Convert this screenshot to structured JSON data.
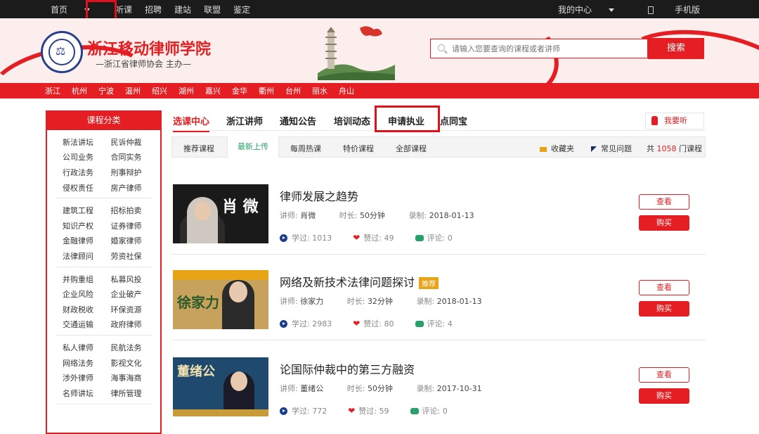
{
  "topnav": {
    "items": [
      "首页",
      "听课",
      "招聘",
      "建站",
      "联盟",
      "鉴定"
    ],
    "my_center": "我的中心",
    "mobile": "手机版"
  },
  "header": {
    "brand": "浙江移动律师学院",
    "subtitle": "—浙江省律师协会 主办—",
    "search_placeholder": "请输入您要查询的课程或者讲师",
    "search_button": "搜索"
  },
  "cities": [
    "浙江",
    "杭州",
    "宁波",
    "温州",
    "绍兴",
    "湖州",
    "嘉兴",
    "金华",
    "衢州",
    "台州",
    "丽水",
    "舟山"
  ],
  "sidebar": {
    "title": "课程分类",
    "groups": [
      [
        [
          "新法讲坛",
          "民诉仲裁"
        ],
        [
          "公司业务",
          "合同实务"
        ],
        [
          "行政法务",
          "刑事辩护"
        ],
        [
          "侵权责任",
          "房产律师"
        ]
      ],
      [
        [
          "建筑工程",
          "招标拍卖"
        ],
        [
          "知识产权",
          "证券律师"
        ],
        [
          "金融律师",
          "婚家律师"
        ],
        [
          "法律顾问",
          "劳资社保"
        ]
      ],
      [
        [
          "并购重组",
          "私募风投"
        ],
        [
          "企业风险",
          "企业破产"
        ],
        [
          "财政税收",
          "环保资源"
        ],
        [
          "交通运输",
          "政府律师"
        ]
      ],
      [
        [
          "私人律师",
          "民航法务"
        ],
        [
          "网络法务",
          "影视文化"
        ],
        [
          "涉外律师",
          "海事海商"
        ],
        [
          "名师讲坛",
          "律所管理"
        ]
      ]
    ]
  },
  "tabs": [
    "选课中心",
    "浙江讲师",
    "通知公告",
    "培训动态",
    "申请执业",
    "点同宝"
  ],
  "want_listen": "我要听",
  "subtabs": [
    "推荐课程",
    "最新上传",
    "每周热课",
    "特价课程",
    "全部课程"
  ],
  "favorites": "收藏夹",
  "faq": "常见问题",
  "total": {
    "prefix": "共",
    "count": "1058",
    "suffix": "门课程"
  },
  "labels": {
    "lecturer": "讲师:",
    "duration": "时长:",
    "recorded": "录制:",
    "studied": "学过:",
    "liked": "赞过:",
    "comments": "评论:",
    "view": "查看",
    "buy": "购买",
    "recommend": "推荐"
  },
  "courses": [
    {
      "title": "律师发展之趋势",
      "lecturer": "肖微",
      "duration": "50分钟",
      "recorded": "2018-01-13",
      "studied": "1013",
      "liked": "49",
      "comments": "0",
      "thumb_text": "肖 微"
    },
    {
      "title": "网络及新技术法律问题探讨",
      "lecturer": "徐家力",
      "duration": "32分钟",
      "recorded": "2018-01-13",
      "studied": "2983",
      "liked": "80",
      "comments": "4",
      "thumb_text": "徐家力"
    },
    {
      "title": "论国际仲裁中的第三方融资",
      "lecturer": "董绪公",
      "duration": "50分钟",
      "recorded": "2017-10-31",
      "studied": "772",
      "liked": "59",
      "comments": "0",
      "thumb_text": "董绪公"
    }
  ]
}
